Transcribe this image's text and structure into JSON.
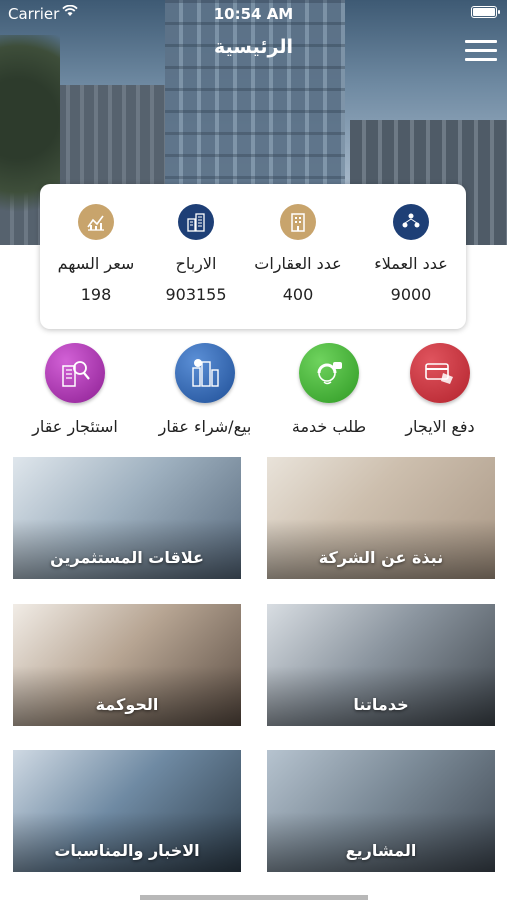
{
  "status_bar": {
    "carrier": "Carrier",
    "time": "10:54 AM"
  },
  "nav": {
    "title": "الرئيسية"
  },
  "stats": [
    {
      "label": "عدد العملاء",
      "value": "9000",
      "icon": "people-network-icon",
      "color": "#1e3f76"
    },
    {
      "label": "عدد العقارات",
      "value": "400",
      "icon": "building-icon",
      "color": "#c8a46c"
    },
    {
      "label": "الارباح",
      "value": "903155",
      "icon": "office-buildings-icon",
      "color": "#1e3f76"
    },
    {
      "label": "سعر السهم",
      "value": "198",
      "icon": "stock-chart-icon",
      "color": "#c8a46c"
    }
  ],
  "services": [
    {
      "label": "دفع الايجار",
      "icon": "credit-card-icon",
      "color": "#c0313b"
    },
    {
      "label": "طلب خدمة",
      "icon": "customer-service-icon",
      "color": "#3aa82f"
    },
    {
      "label": "بيع/شراء عقار",
      "icon": "city-money-icon",
      "color": "#2a5ea8"
    },
    {
      "label": "استئجار عقار",
      "icon": "building-search-icon",
      "color": "#a12fa6"
    }
  ],
  "tiles": [
    {
      "label": "نبذة عن الشركة"
    },
    {
      "label": "علاقات المستثمرين"
    },
    {
      "label": "خدماتنا"
    },
    {
      "label": "الحوكمة"
    },
    {
      "label": "المشاريع"
    },
    {
      "label": "الاخبار والمناسبات"
    }
  ]
}
